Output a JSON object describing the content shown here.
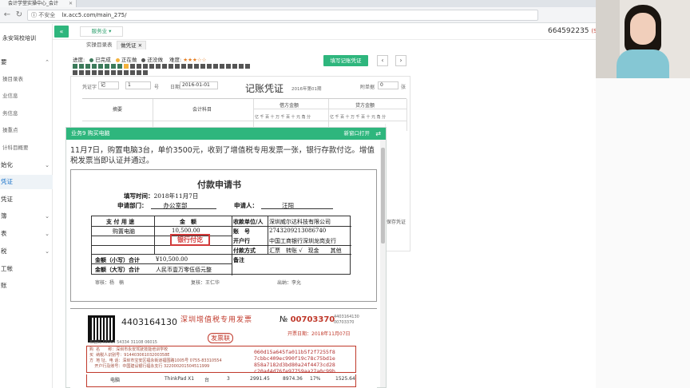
{
  "browser": {
    "tab_label": "会计学堂实操中心_会计",
    "address_insecure": "不安全",
    "address_url": "lx.acc5.com/main_275/"
  },
  "sidebar": {
    "title": "永安驾校培训",
    "items": [
      {
        "label": "要",
        "chevron": "^"
      },
      {
        "label": "操目录表"
      },
      {
        "label": "业信息"
      },
      {
        "label": "务信息"
      },
      {
        "label": "操重点"
      },
      {
        "label": "计科目概要"
      },
      {
        "label": "始化",
        "chevron": "v"
      },
      {
        "label": "凭证"
      },
      {
        "label": "凭证"
      },
      {
        "label": "簿",
        "chevron": "v"
      },
      {
        "label": "表",
        "chevron": "v"
      },
      {
        "label": "税",
        "chevron": "v"
      },
      {
        "label": "工帐"
      },
      {
        "label": "账"
      }
    ]
  },
  "topbar": {
    "collapse_icon": "«",
    "service_label": "服务业 ▾",
    "user_id": "664592235",
    "user_badge": "(SVI"
  },
  "page_tabs": [
    "实操目录表",
    "做凭证"
  ],
  "progress": {
    "label": "进度:",
    "done": "已完成",
    "current": "正在做",
    "todo": "还没做",
    "difficulty_label": "难度:",
    "difficulty_stars": "★★★☆☆"
  },
  "fill_button": "填写记账凭证",
  "voucher": {
    "word_label": "凭证字",
    "word_value": "记",
    "number_value": "1",
    "number_label": "号",
    "date_label": "日期",
    "date_value": "2016-01-01",
    "title": "记账凭证",
    "period": "2016年第01期",
    "attach_label": "附单据",
    "attach_value": "0",
    "attach_unit": "张",
    "col_summary": "摘要",
    "col_account": "会计科目",
    "col_debit": "借方金额",
    "col_credit": "贷方金额",
    "digits": "亿千百十万千百十元角分",
    "save_label": "保存凭证"
  },
  "task": {
    "header": "业务9 购买电脑",
    "new_window": "新窗口打开",
    "swap_icon": "⇄",
    "description": "11月7日，购置电脑3台，单价3500元，收到了增值税专用发票一张，银行存款付讫。增值税发票当即认证并通过。"
  },
  "payment_request": {
    "title": "付款申请书",
    "fill_time_label": "填写时间：",
    "fill_time_value": "2018年11月7日",
    "dept_label": "申请部门：",
    "dept_value": "办公室部",
    "applicant_label": "申请人：",
    "applicant_value": "汪阳",
    "col_use": "支 付 用 途",
    "col_amount": "金　额",
    "col_payee": "收款单位/人",
    "use_value": "购置电脑",
    "amount_value": "10,500.00",
    "payee_value": "深圳威尔达科技有限公司",
    "account_label": "账　号",
    "account_value": "2743209213086740",
    "bank_label": "开户行",
    "bank_value": "中国工商银行深圳龙岗支行",
    "method_label": "付款方式",
    "method_value": "汇票　转账 √　现金　　其他",
    "stamp": "银行付讫",
    "lower_label": "金额（小写）合计",
    "lower_value": "¥10,500.00",
    "upper_label": "金额（大写）合计",
    "upper_value": "人民币壹万零伍佰元整",
    "remark_label": "备注",
    "approve": "审核：杨　楠",
    "review": "复核：王仁华",
    "cashier": "出纳：李允"
  },
  "invoice": {
    "code": "4403164130",
    "title": "深圳增值税专用发票",
    "red_label": "发票联",
    "no_label": "№",
    "no_value": "00703370",
    "code_small_1": "4403164130",
    "code_small_2": "00703370",
    "date": "开票日期：2018年11月07日",
    "check_code": "校验码 68564 54334 31108 06015",
    "buyer_lines": "购  名　　称：深圳市永安驾驶技能培训学校\n买  纳税人识别号：91440306103200358E\n方  地 址、电 话：深圳市宝安区福永街道福围路1005号 0755-83310554\n    开户行及账号：中国建设银行福永支行 322000201504511999",
    "password_area": "060d15a645fa011b5f2f7255f8\n7cbbc409ec990f19c78c75bd1e\n858a7182d3bd80a24f4473cd28\nc20ad4d76fe97759aa27a0c99b",
    "item_name": "电脑",
    "item_model": "ThinkPad X1",
    "item_unit": "台",
    "item_qty": "3",
    "item_price": "2991.45",
    "item_amount": "8974.36",
    "item_rate": "17%",
    "item_tax": "1525.64"
  }
}
